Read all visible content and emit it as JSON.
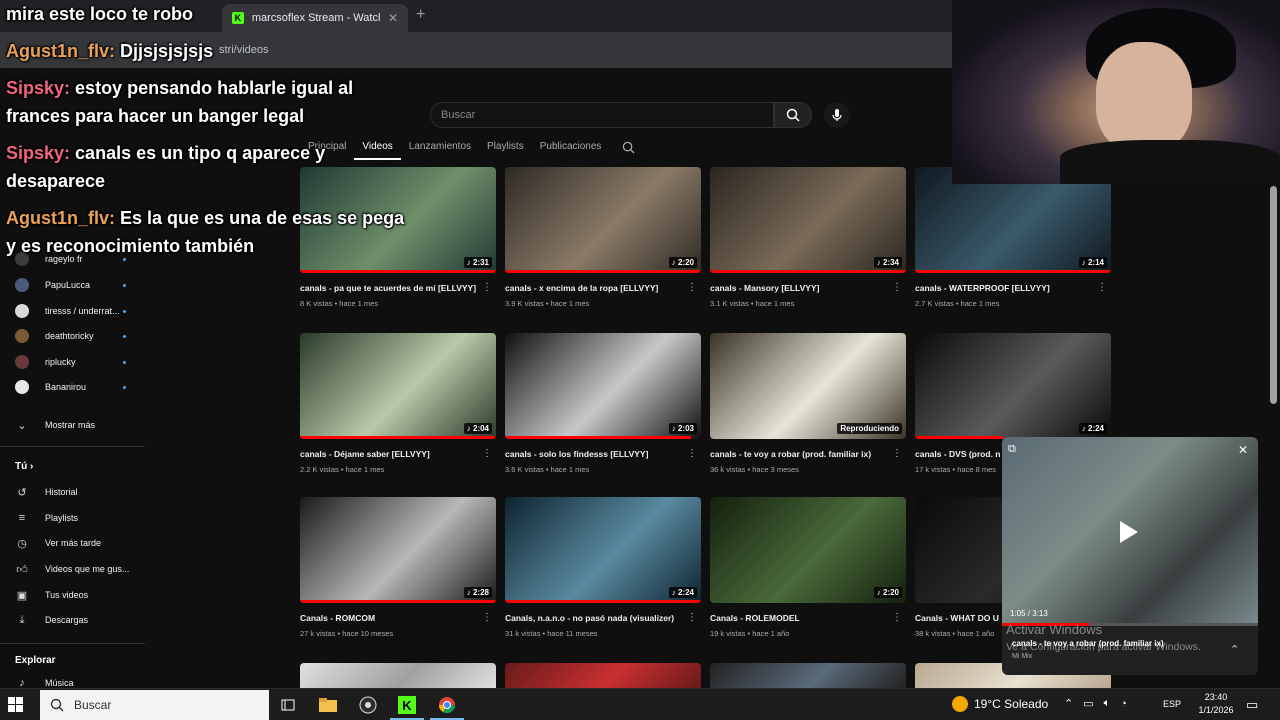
{
  "browser": {
    "tab1_title": "",
    "tab2_title": "marcsoflex Stream - Watch Live",
    "kick_logo": "K",
    "url": "stri/videos"
  },
  "youtube": {
    "search_placeholder": "Buscar",
    "channel_tabs": [
      "Principal",
      "Videos",
      "Lanzamientos",
      "Playlists",
      "Publicaciones"
    ],
    "active_tab": "Videos"
  },
  "sidebar": {
    "subscriptions": [
      {
        "name": "rageylo fr",
        "color": "#3b3b3b"
      },
      {
        "name": "PapuLucca",
        "color": "#4a5a7a"
      },
      {
        "name": "tiresss / underrat...",
        "color": "#d8d8d8"
      },
      {
        "name": "deathtoricky",
        "color": "#7a5a30"
      },
      {
        "name": "riplucky",
        "color": "#6a3a3a"
      },
      {
        "name": "Bananirou",
        "color": "#e8e8e8"
      }
    ],
    "show_more": "Mostrar más",
    "you_section": "Tú",
    "you_items": [
      {
        "label": "Historial",
        "icon": "history-icon"
      },
      {
        "label": "Playlists",
        "icon": "playlists-icon"
      },
      {
        "label": "Ver más tarde",
        "icon": "watch-later-icon"
      },
      {
        "label": "Videos que me gus...",
        "icon": "like-icon"
      },
      {
        "label": "Tus videos",
        "icon": "your-videos-icon"
      },
      {
        "label": "Descargas",
        "icon": "downloads-icon"
      }
    ],
    "explore_section": "Explorar",
    "explore_items": [
      {
        "label": "Música",
        "icon": "music-icon"
      }
    ]
  },
  "videos": [
    {
      "title": "canals - pa que te acuerdes de mí [ELLVYY]",
      "meta": "8 K vistas • hace 1 mes",
      "duration": "♪ 2:31",
      "progress": 1.0,
      "c1": "#1e3a34",
      "c2": "#6f8f6a"
    },
    {
      "title": "canals - x encima de la ropa [ELLVYY]",
      "meta": "3.9 K vistas • hace 1 mes",
      "duration": "♪ 2:20",
      "progress": 1.0,
      "c1": "#2e2a26",
      "c2": "#8a7a66"
    },
    {
      "title": "canals - Mansory [ELLVYY]",
      "meta": "3.1 K vistas • hace 1 mes",
      "duration": "♪ 2:34",
      "progress": 1.0,
      "c1": "#2a2620",
      "c2": "#7a6a58"
    },
    {
      "title": "canals - WATERPROOF [ELLVYY]",
      "meta": "2.7 K vistas • hace 1 mes",
      "duration": "♪ 2:14",
      "progress": 1.0,
      "c1": "#101820",
      "c2": "#3a5a6a"
    },
    {
      "title": "canals - Déjame saber [ELLVYY]",
      "meta": "2.2 K vistas • hace 1 mes",
      "duration": "♪ 2:04",
      "progress": 1.0,
      "c1": "#2a3a2a",
      "c2": "#b8c8a8"
    },
    {
      "title": "canals - solo los findesss [ELLVYY]",
      "meta": "3.6 K vistas • hace 1 mes",
      "duration": "♪ 2:03",
      "progress": 0.95,
      "c1": "#101010",
      "c2": "#c8c8c8"
    },
    {
      "title": "canals - te voy a robar (prod. familiar ix)",
      "meta": "36 k vistas • hace 3 meses",
      "duration": "Reproduciendo",
      "progress": 0.0,
      "c1": "#3a3428",
      "c2": "#e8e4d8"
    },
    {
      "title": "canals - DVS (prod. n",
      "meta": "17 k vistas • hace 8 mes",
      "duration": "♪ 2:24",
      "progress": 0.45,
      "c1": "#0a0a0a",
      "c2": "#5a5a5a"
    },
    {
      "title": "Canals - ROMCOM",
      "meta": "27 k vistas • hace 10 meses",
      "duration": "♪ 2:28",
      "progress": 1.0,
      "c1": "#1a1a1a",
      "c2": "#b8b8b8"
    },
    {
      "title": "Canals, n.a.n.o - no pasó nada (visualizer)",
      "meta": "31 k vistas • hace 11 meses",
      "duration": "♪ 2:24",
      "progress": 1.0,
      "c1": "#0e2430",
      "c2": "#5a8aa0"
    },
    {
      "title": "Canals - ROLEMODEL",
      "meta": "19 k vistas • hace 1 año",
      "duration": "♪ 2:20",
      "progress": 0.0,
      "c1": "#14200e",
      "c2": "#4a6a3a"
    },
    {
      "title": "Canals - WHAT DO U",
      "meta": "38 k vistas • hace 1 año",
      "duration": "",
      "progress": 0.0,
      "c1": "#0a0a0a",
      "c2": "#2a2a2a"
    },
    {
      "title": "",
      "meta": "",
      "duration": "",
      "progress": 0.0,
      "c1": "#e0e0e0",
      "c2": "#a0a0a0"
    },
    {
      "title": "",
      "meta": "",
      "duration": "",
      "progress": 0.0,
      "c1": "#6a1a1a",
      "c2": "#c83030"
    },
    {
      "title": "",
      "meta": "",
      "duration": "",
      "progress": 0.0,
      "c1": "#222",
      "c2": "#5a6a7a"
    },
    {
      "title": "",
      "meta": "",
      "duration": "",
      "progress": 0.0,
      "c1": "#b8a890",
      "c2": "#e8e0d0"
    }
  ],
  "miniplayer": {
    "time": "1:05 / 3:13",
    "progress": 0.34,
    "title": "canals - te voy a robar (prod. familiar ix)",
    "subtitle": "Mi Mix"
  },
  "windows_activation": {
    "line1": "Activar Windows",
    "line2": "Ve a Configuración para activar Windows."
  },
  "chat": [
    {
      "user": "",
      "text": "mira este loco te robo",
      "user_color": "orange"
    },
    {
      "user": "Agust1n_flv:",
      "text": "Djjsjsjsjsjs",
      "user_color": "orange"
    },
    {
      "user": "Sipsky:",
      "text": "estoy pensando hablarle igual al",
      "cont": "frances para hacer un banger legal",
      "user_color": "pink"
    },
    {
      "user": "Sipsky:",
      "text": "canals es un tipo q aparece y",
      "cont": "desaparece",
      "user_color": "pink"
    },
    {
      "user": "Agust1n_flv:",
      "text": "Es la que es una de esas se pega",
      "cont": "y es reconocimiento también",
      "user_color": "orange"
    }
  ],
  "taskbar": {
    "search_placeholder": "Buscar",
    "weather": "19°C  Soleado",
    "lang": "ESP",
    "time": "23:40",
    "date": "1/1/2026"
  }
}
